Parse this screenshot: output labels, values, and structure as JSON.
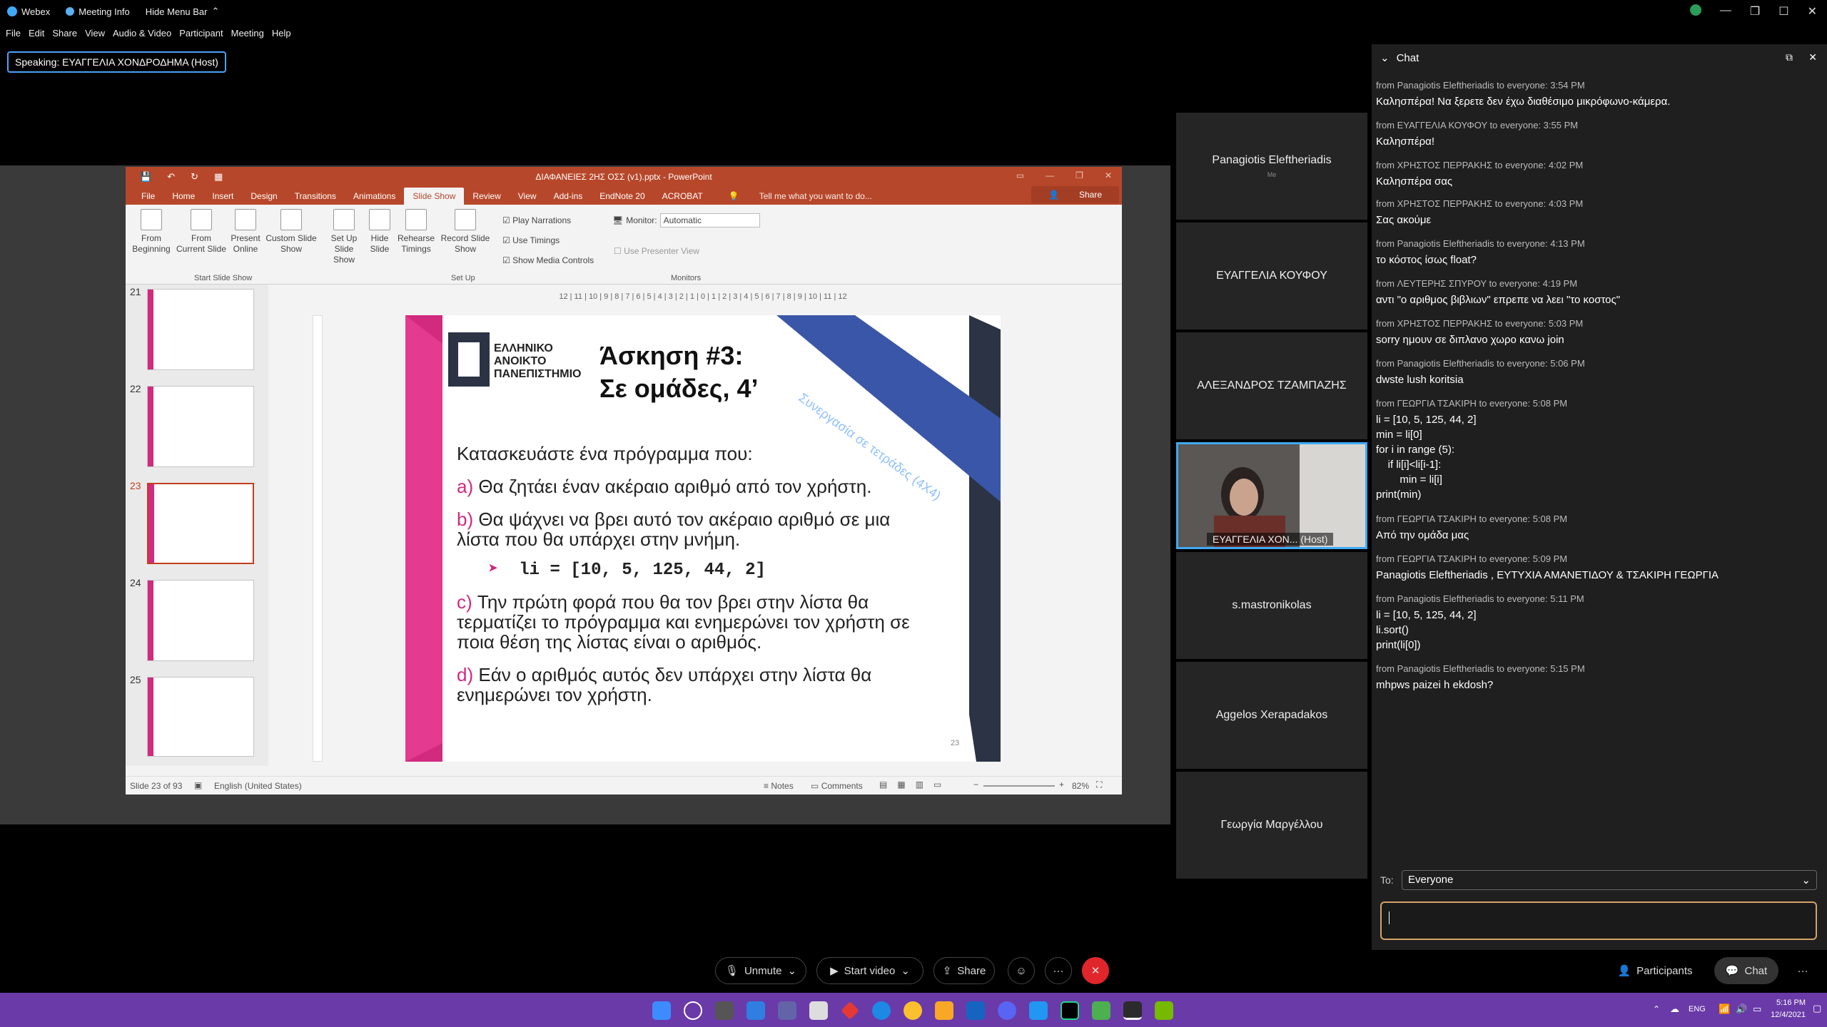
{
  "app": {
    "name": "Webex",
    "meeting_info": "Meeting Info",
    "hide_menu_bar": "Hide Menu Bar",
    "speaking": "Speaking: ΕΥΑΓΓΕΛΙΑ ΧΟΝΔΡΟΔΗΜΑ (Host)"
  },
  "menu": [
    "File",
    "Edit",
    "Share",
    "View",
    "Audio & Video",
    "Participant",
    "Meeting",
    "Help"
  ],
  "ppt": {
    "title": "ΔΙΑΦΑΝΕΙΕΣ 2ΗΣ ΟΣΣ (v1).pptx - PowerPoint",
    "tabs": [
      "File",
      "Home",
      "Insert",
      "Design",
      "Transitions",
      "Animations",
      "Slide Show",
      "Review",
      "View",
      "Add-ins",
      "EndNote 20",
      "ACROBAT"
    ],
    "tell_me": "Tell me what you want to do...",
    "share": "Share",
    "ribbon": {
      "from_beginning": [
        "From",
        "Beginning"
      ],
      "from_current": [
        "From",
        "Current Slide"
      ],
      "present_online": [
        "Present",
        "Online"
      ],
      "custom_show": [
        "Custom Slide",
        "Show"
      ],
      "group1": "Start Slide Show",
      "setup": [
        "Set Up",
        "Slide Show"
      ],
      "hide": [
        "Hide",
        "Slide"
      ],
      "rehearse": [
        "Rehearse",
        "Timings"
      ],
      "record": [
        "Record Slide",
        "Show"
      ],
      "play_narrations": "Play Narrations",
      "use_timings": "Use Timings",
      "show_media": "Show Media Controls",
      "group2": "Set Up",
      "monitor_label": "Monitor:",
      "monitor_value": "Automatic",
      "presenter_view": "Use Presenter View",
      "group3": "Monitors"
    },
    "thumbs": [
      "21",
      "22",
      "23",
      "24",
      "25"
    ],
    "ruler": "12 | 11 | 10 | 9 | 8 | 7 | 6 | 5 | 4 | 3 | 2 | 1 | 0 | 1 | 2 | 3 | 4 | 5 | 6 | 7 | 8 | 9 | 10 | 11 | 12",
    "slide": {
      "logo_lines": [
        "ΕΛΛΗΝΙΚΟ",
        "ΑΝΟΙΚΤΟ",
        "ΠΑΝΕΠΙΣΤΗΜΙΟ"
      ],
      "heading1": "Άσκηση #3:",
      "heading2": "Σε ομάδες, 4’",
      "banner1": "Άσκηση 3",
      "banner2": "Συνεργασία σε τετράδες (4Χ4)",
      "intro": "Κατασκευάστε ένα πρόγραμμα που:",
      "a_label": "a)",
      "a_text": "Θα ζητάει έναν ακέραιο αριθμό από τον χρήστη.",
      "b_label": "b)",
      "b_text1": "Θα ψάχνει να βρει αυτό τον ακέραιο αριθμό σε μια",
      "b_text2": "λίστα που θα υπάρχει στην μνήμη.",
      "code": "li = [10, 5, 125, 44, 2]",
      "c_label": "c)",
      "c_text1": "Την πρώτη φορά που θα τον βρει στην λίστα θα",
      "c_text2": "τερματίζει το πρόγραμμα και ενημερώνει τον χρήστη σε",
      "c_text3": "ποια θέση της λίστας είναι ο αριθμός.",
      "d_label": "d)",
      "d_text1": "Εάν ο αριθμός αυτός δεν υπάρχει στην λίστα θα",
      "d_text2": "ενημερώνει τον χρήστη.",
      "page_num": "23"
    },
    "status": {
      "slide_info": "Slide 23 of 93",
      "language": "English (United States)",
      "notes": "Notes",
      "comments": "Comments",
      "zoom": "82%"
    }
  },
  "participants": [
    {
      "name": "Panagiotis Eleftheriadis",
      "sub": "Me"
    },
    {
      "name": "ΕΥΑΓΓΕΛΙΑ ΚΟΥΦΟΥ",
      "sub": ""
    },
    {
      "name": "ΑΛΕΞΑΝΔΡΟΣ ΤΖΑΜΠΑΖΗΣ",
      "sub": ""
    },
    {
      "name": "ΕΥΑΓΓΕΛΙΑ ΧΟΝ... (Host)",
      "sub": ""
    },
    {
      "name": "s.mastronikolas",
      "sub": ""
    },
    {
      "name": "Aggelos Xerapadakos",
      "sub": ""
    },
    {
      "name": "Γεωργία Μαργέλλου",
      "sub": ""
    }
  ],
  "chat": {
    "title": "Chat",
    "messages": [
      {
        "meta": "from Panagiotis Eleftheriadis to everyone:    3:54 PM",
        "text": "Καλησπέρα! Να ξερετε δεν έχω διαθέσιμο μικρόφωνο-κάμερα."
      },
      {
        "meta": "from ΕΥΑΓΓΕΛΙΑ ΚΟΥΦΟΥ to everyone:    3:55 PM",
        "text": "Καλησπέρα!"
      },
      {
        "meta": "from ΧΡΗΣΤΟΣ ΠΕΡΡΑΚΗΣ to everyone:    4:02 PM",
        "text": "Καλησπέρα σας"
      },
      {
        "meta": "from ΧΡΗΣΤΟΣ ΠΕΡΡΑΚΗΣ to everyone:    4:03 PM",
        "text": "Σας ακούμε"
      },
      {
        "meta": "from Panagiotis Eleftheriadis to everyone:    4:13 PM",
        "text": "το κόστος ίσως float?"
      },
      {
        "meta": "from ΛΕΥΤΕΡΗΣ ΣΠΥΡΟΥ to everyone:    4:19 PM",
        "text": "αντι \"ο αριθμος βιβλιων\" επρεπε να λεει \"το κοστος\""
      },
      {
        "meta": "from ΧΡΗΣΤΟΣ ΠΕΡΡΑΚΗΣ to everyone:    5:03 PM",
        "text": "sorry ημουν σε διπλανο χωρο κανω join"
      },
      {
        "meta": "from Panagiotis Eleftheriadis to everyone:    5:06 PM",
        "text": "dwste lush koritsia"
      },
      {
        "meta": "from ΓΕΩΡΓΙΑ ΤΣΑΚΙΡΗ to everyone:    5:08 PM",
        "text": "li = [10, 5, 125, 44, 2]\nmin = li[0]\nfor i in range (5):\n    if li[i]<li[i-1]:\n        min = li[i]\nprint(min)"
      },
      {
        "meta": "from ΓΕΩΡΓΙΑ ΤΣΑΚΙΡΗ to everyone:    5:08 PM",
        "text": "Από την ομάδα μας"
      },
      {
        "meta": "from ΓΕΩΡΓΙΑ ΤΣΑΚΙΡΗ to everyone:    5:09 PM",
        "text": "Panagiotis Eleftheriadis , ΕΥΤΥΧΙΑ ΑΜΑΝΕΤΙΔΟΥ & ΤΣΑΚΙΡΗ ΓΕΩΡΓΙΑ"
      },
      {
        "meta": "from Panagiotis Eleftheriadis to everyone:    5:11 PM",
        "text": "li = [10, 5, 125, 44, 2]\nli.sort()\nprint(li[0])"
      },
      {
        "meta": "from Panagiotis Eleftheriadis to everyone:    5:15 PM",
        "text": "mhpws paizei h ekdosh?"
      }
    ],
    "to_label": "To:",
    "to_value": "Everyone",
    "input_placeholder": ""
  },
  "controls": {
    "unmute": "Unmute",
    "start_video": "Start video",
    "share": "Share",
    "participants": "Participants",
    "chat": "Chat"
  },
  "taskbar": {
    "lang": "ENG",
    "time": "5:16 PM",
    "date": "12/4/2021"
  },
  "colors": {
    "ppt_red": "#b7472a",
    "slide_magenta": "#d12a7f",
    "banner_blue": "#3a56a8",
    "end_call": "#e0262b",
    "taskbar": "#6a3aa8",
    "accent_blue": "#4aa3ff"
  }
}
